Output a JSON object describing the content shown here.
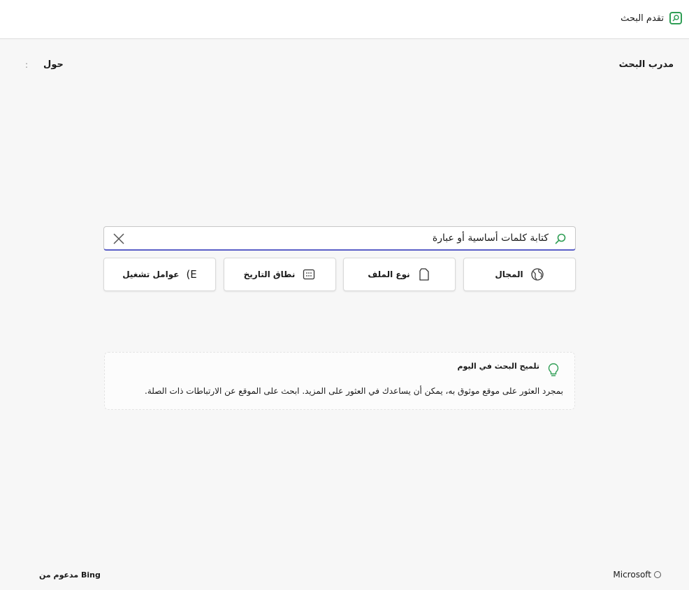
{
  "header": {
    "app_title": "تقدم البحث",
    "logo_icon": "search-logo-icon",
    "accent_color": "#2f9e55"
  },
  "nav": {
    "trainer_label": "مدرب البحث",
    "about_label": "حول",
    "more_label": ":"
  },
  "search": {
    "placeholder": "كتابة كلمات أساسية أو عبارة",
    "underline_color": "#5b5fc7"
  },
  "filters": [
    {
      "label": "المجال",
      "icon": "globe-icon"
    },
    {
      "label": "نوع الملف",
      "icon": "file-icon"
    },
    {
      "label": "نطاق التاريخ",
      "icon": "calendar-icon"
    },
    {
      "label": "عوامل تشغيل",
      "glyph": "(E"
    }
  ],
  "tip": {
    "title": "تلميح البحث في اليوم",
    "body": "بمجرد العثور على موقع موثوق به، يمكن أن يساعدك في العثور على المزيد. ابحث على الموقع عن الارتباطات ذات الصلة."
  },
  "footer": {
    "powered_by": "مدعوم من Bing",
    "brand": "Microsoft"
  }
}
